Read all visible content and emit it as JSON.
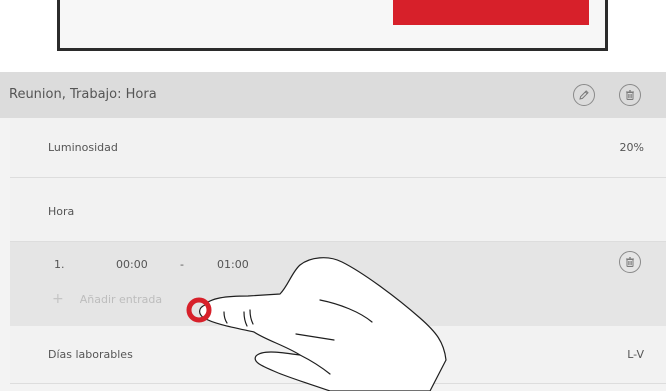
{
  "schedule": {
    "title": "Reunion, Trabajo: Hora",
    "icons": {
      "edit": "pencil-icon",
      "delete": "trash-icon"
    }
  },
  "rows": {
    "luminosidad": {
      "label": "Luminosidad",
      "value": "20%"
    },
    "hora": {
      "label": "Hora"
    },
    "entries": [
      {
        "num": "1.",
        "start": "00:00",
        "dash": "-",
        "end": "01:00"
      }
    ],
    "add_entry": "Añadir entrada",
    "dias": {
      "label": "Días laborables",
      "value": "L-V"
    }
  },
  "colors": {
    "accent_red": "#d7202a",
    "header_bg": "#dcdcdc",
    "row_bg": "#f2f2f2",
    "entries_bg": "#e5e5e5"
  }
}
